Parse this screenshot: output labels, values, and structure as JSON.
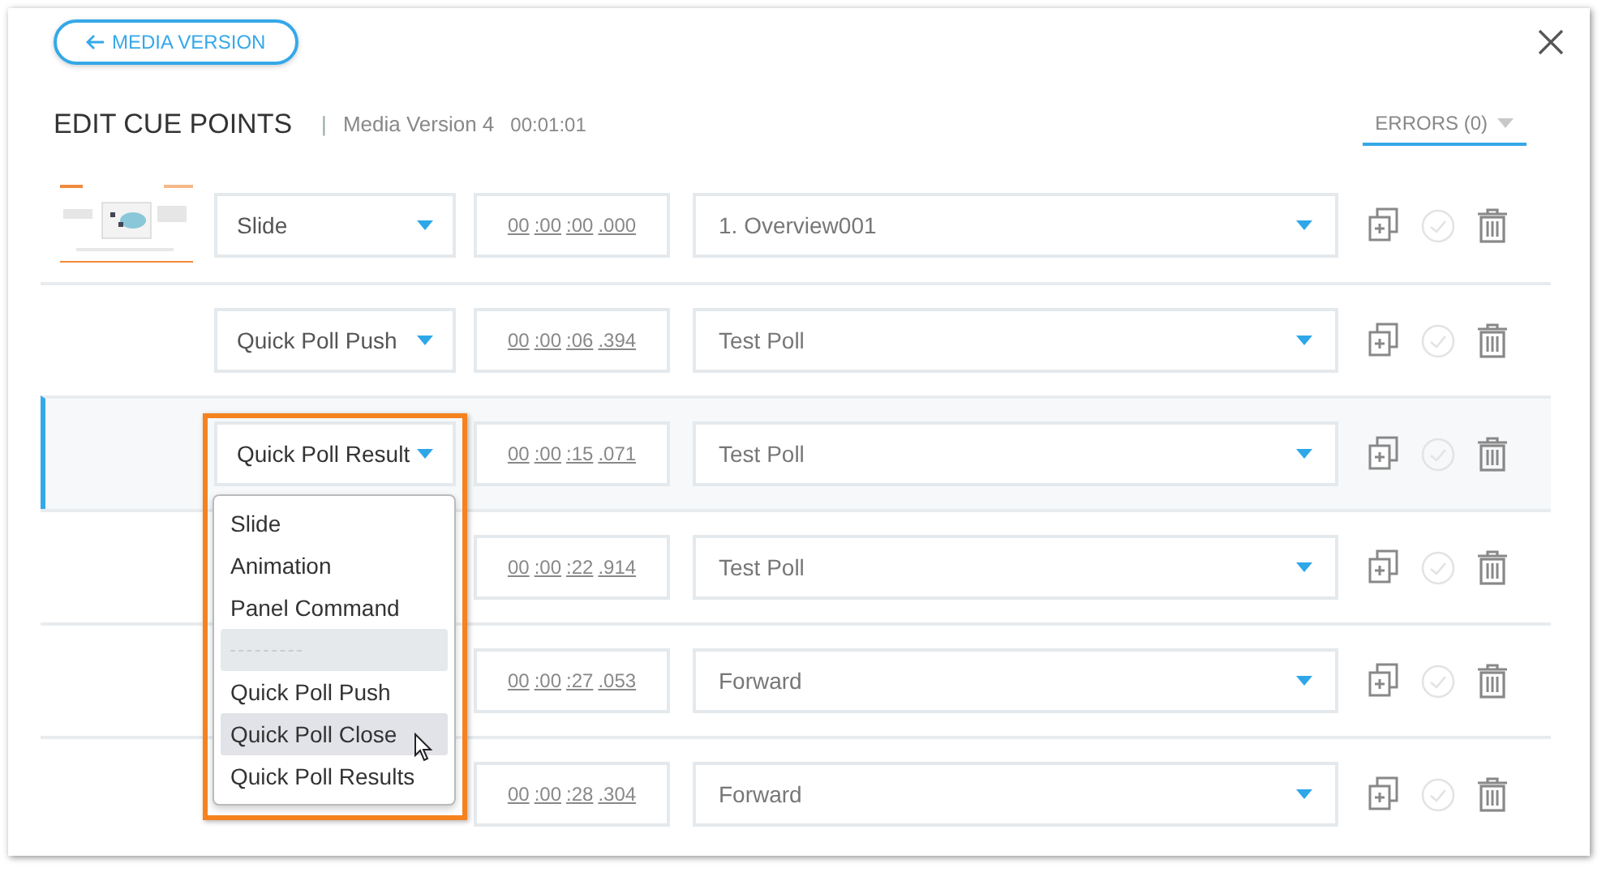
{
  "back_button": {
    "label": "MEDIA VERSION"
  },
  "title": "EDIT CUE POINTS",
  "separator": "|",
  "media_version": "Media Version 4",
  "duration": "00:01:01",
  "errors_tab": {
    "label": "ERRORS (0)",
    "selected": true
  },
  "rows": [
    {
      "thumbnail": true,
      "type": "Slide",
      "time": [
        "00",
        ":00",
        ":00",
        ".000"
      ],
      "target": "1. Overview001",
      "selected": false
    },
    {
      "thumbnail": false,
      "type": "Quick Poll Push",
      "time": [
        "00",
        ":00",
        ":06",
        ".394"
      ],
      "target": "Test Poll",
      "selected": false
    },
    {
      "thumbnail": false,
      "type": "Quick Poll Result",
      "time": [
        "00",
        ":00",
        ":15",
        ".071"
      ],
      "target": "Test Poll",
      "selected": true
    },
    {
      "thumbnail": false,
      "time": [
        "00",
        ":00",
        ":22",
        ".914"
      ],
      "target": "Test Poll",
      "selected": false
    },
    {
      "thumbnail": false,
      "time": [
        "00",
        ":00",
        ":27",
        ".053"
      ],
      "target": "Forward",
      "selected": false
    },
    {
      "thumbnail": false,
      "time": [
        "00",
        ":00",
        ":28",
        ".304"
      ],
      "target": "Forward",
      "selected": false
    }
  ],
  "type_menu": {
    "items": [
      {
        "kind": "option",
        "label": "Slide",
        "selected": false
      },
      {
        "kind": "option",
        "label": "Animation",
        "selected": false
      },
      {
        "kind": "option",
        "label": "Panel Command",
        "selected": false
      },
      {
        "kind": "separator"
      },
      {
        "kind": "option",
        "label": "Quick Poll Push",
        "selected": false
      },
      {
        "kind": "option",
        "label": "Quick Poll Close",
        "selected": true
      },
      {
        "kind": "option",
        "label": "Quick Poll Results",
        "selected": false
      }
    ]
  }
}
